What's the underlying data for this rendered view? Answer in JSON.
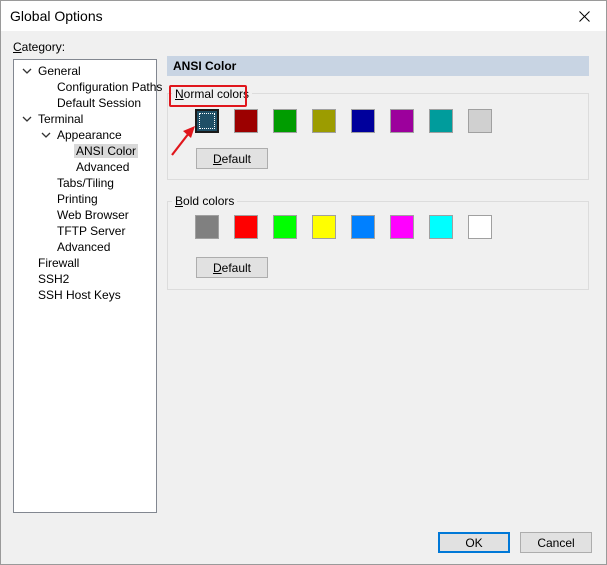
{
  "window": {
    "title": "Global Options"
  },
  "category": {
    "label_ul": "C",
    "label_rest": "ategory:"
  },
  "tree": {
    "items": [
      {
        "label": "General"
      },
      {
        "label": "Configuration Paths"
      },
      {
        "label": "Default Session"
      },
      {
        "label": "Terminal"
      },
      {
        "label": "Appearance"
      },
      {
        "label": "ANSI Color"
      },
      {
        "label": "Advanced"
      },
      {
        "label": "Tabs/Tiling"
      },
      {
        "label": "Printing"
      },
      {
        "label": "Web Browser"
      },
      {
        "label": "TFTP Server"
      },
      {
        "label": "Advanced"
      },
      {
        "label": "Firewall"
      },
      {
        "label": "SSH2"
      },
      {
        "label": "SSH Host Keys"
      }
    ],
    "selected_index": 5
  },
  "panel": {
    "header": "ANSI Color"
  },
  "normal": {
    "legend_ul": "N",
    "legend_rest": "ormal colors",
    "colors": [
      "#1f4f66",
      "#9c0000",
      "#009c00",
      "#9c9c00",
      "#00009c",
      "#9c009c",
      "#009c9c",
      "#d0d0d0"
    ],
    "default_ul": "D",
    "default_rest": "efault"
  },
  "bold": {
    "legend_ul": "B",
    "legend_rest": "old colors",
    "colors": [
      "#808080",
      "#ff0000",
      "#00ff00",
      "#ffff00",
      "#0080ff",
      "#ff00ff",
      "#00ffff",
      "#ffffff"
    ],
    "default_ul": "D",
    "default_rest": "efault"
  },
  "buttons": {
    "ok": "OK",
    "cancel": "Cancel"
  },
  "annotation_color": "#e0161c"
}
